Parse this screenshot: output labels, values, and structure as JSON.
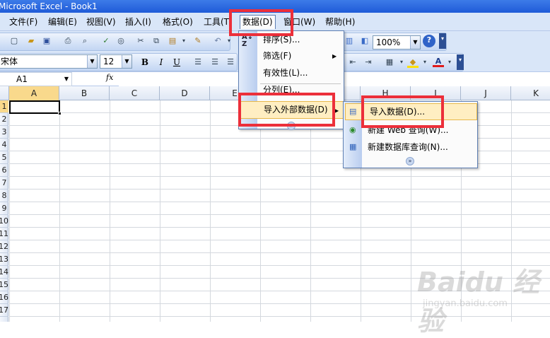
{
  "window": {
    "title": "Microsoft Excel - Book1"
  },
  "menubar": [
    {
      "label": "文件(F)"
    },
    {
      "label": "编辑(E)"
    },
    {
      "label": "视图(V)"
    },
    {
      "label": "插入(I)"
    },
    {
      "label": "格式(O)"
    },
    {
      "label": "工具(T)"
    },
    {
      "label": "数据(D)"
    },
    {
      "label": "窗口(W)"
    },
    {
      "label": "帮助(H)"
    }
  ],
  "toolbar": {
    "zoom": "100%",
    "font_name": "宋体",
    "font_size": "12",
    "bold": "B",
    "italic": "I",
    "underline": "U"
  },
  "formula": {
    "cell_ref": "A1",
    "fx": "fx"
  },
  "columns": [
    "A",
    "B",
    "C",
    "D",
    "E",
    "F",
    "G",
    "H",
    "I",
    "J",
    "K"
  ],
  "rows": [
    "1",
    "2",
    "3",
    "4",
    "5",
    "6",
    "7",
    "8",
    "9",
    "10",
    "11",
    "12",
    "13",
    "14",
    "15",
    "16",
    "17"
  ],
  "data_menu": {
    "items": [
      "排序(S)...",
      "筛选(F)",
      "有效性(L)...",
      "分列(E)...",
      "导入外部数据(D)"
    ]
  },
  "import_submenu": {
    "items": [
      "导入数据(D)...",
      "新建 Web 查询(W)...",
      "新建数据库查询(N)..."
    ]
  },
  "watermark": {
    "brand": "Baidu 经验",
    "url": "jingyan.baidu.com"
  },
  "colors": {
    "highlight_box": "#ec2f3a",
    "menu_hover": "#ffeec2",
    "titlebar": "#1f5bd8"
  }
}
